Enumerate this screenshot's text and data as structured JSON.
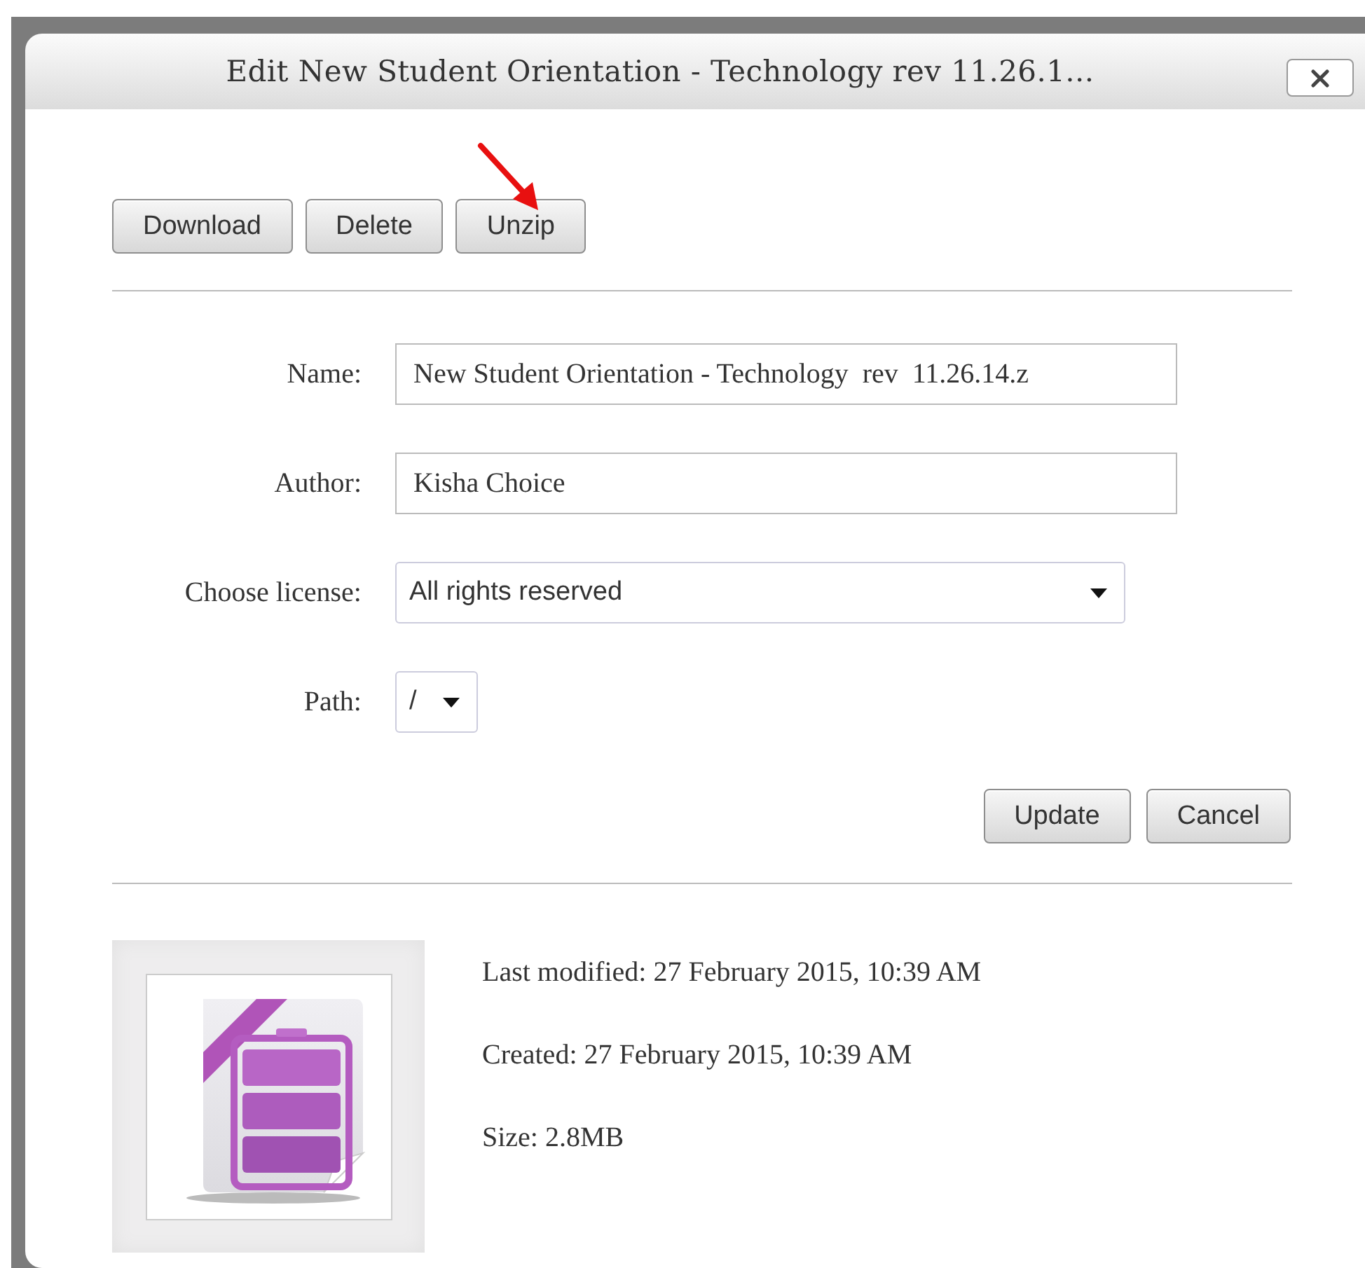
{
  "dialog": {
    "title": "Edit New Student Orientation - Technology rev 11.26.1..."
  },
  "file_actions": [
    "Download",
    "Delete",
    "Unzip"
  ],
  "fields": [
    {
      "kind": "text",
      "label": "Name:",
      "value": "New Student Orientation - Technology  rev  11.26.14.z"
    },
    {
      "kind": "text",
      "label": "Author:",
      "value": "Kisha Choice"
    },
    {
      "kind": "select",
      "label": "Choose license:",
      "value": "All rights reserved"
    },
    {
      "kind": "small-select",
      "label": "Path:",
      "value": "/"
    }
  ],
  "form_buttons": [
    "Update",
    "Cancel"
  ],
  "file_info": [
    "Last modified: 27 February 2015, 10:39 AM",
    "Created: 27 February 2015, 10:39 AM",
    "Size: 2.8MB"
  ]
}
